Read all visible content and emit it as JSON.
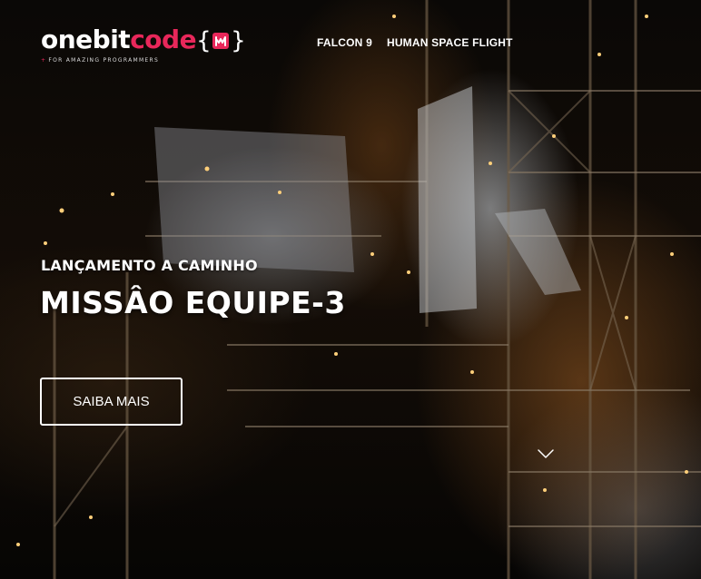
{
  "brand": {
    "name_part1": "onebit",
    "name_part2": "code",
    "brace_open": "{",
    "brace_close": "}",
    "badge_icon": "rock-hand-icon",
    "tagline": "FOR AMAZING PROGRAMMERS",
    "tagline_prefix": "+",
    "accent_color": "#e8275a"
  },
  "nav": {
    "items": [
      {
        "label": "FALCON 9"
      },
      {
        "label": "HUMAN SPACE FLIGHT"
      }
    ]
  },
  "hero": {
    "eyebrow": "LANÇAMENTO A CAMINHO",
    "title": "MISSÂO EQUIPE-3",
    "cta_label": "SAIBA MAIS",
    "scroll_icon": "chevron-down-icon",
    "background_image": "launch-tower-at-night"
  }
}
